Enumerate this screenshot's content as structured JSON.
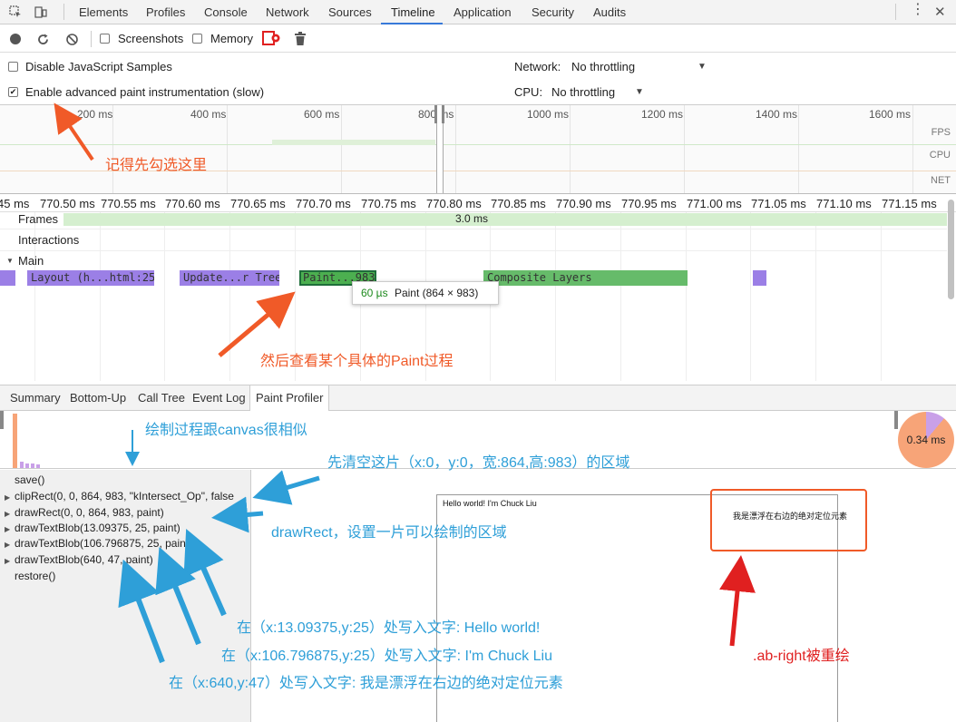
{
  "tabs": [
    "Elements",
    "Profiles",
    "Console",
    "Network",
    "Sources",
    "Timeline",
    "Application",
    "Security",
    "Audits"
  ],
  "active_tab": "Timeline",
  "toolbar": {
    "screenshots_label": "Screenshots",
    "memory_label": "Memory"
  },
  "settings": {
    "disable_js_samples": "Disable JavaScript Samples",
    "enable_paint": "Enable advanced paint instrumentation (slow)",
    "network_label": "Network:",
    "network_value": "No throttling",
    "cpu_label": "CPU:",
    "cpu_value": "No throttling"
  },
  "overview": {
    "ticks": [
      "200 ms",
      "400 ms",
      "600 ms",
      "800 ms",
      "1000 ms",
      "1200 ms",
      "1400 ms",
      "1600 ms"
    ],
    "tracks": [
      "FPS",
      "CPU",
      "NET"
    ]
  },
  "flame": {
    "ticks": [
      "45 ms",
      "770.50 ms",
      "770.55 ms",
      "770.60 ms",
      "770.65 ms",
      "770.70 ms",
      "770.75 ms",
      "770.80 ms",
      "770.85 ms",
      "770.90 ms",
      "770.95 ms",
      "771.00 ms",
      "771.05 ms",
      "771.10 ms",
      "771.15 ms"
    ],
    "rows": {
      "frames": "Frames",
      "frame_duration": "3.0 ms",
      "interactions": "Interactions",
      "main": "Main"
    },
    "events": [
      "Layout (h...html:25)",
      "Update...r Tree",
      "Paint...983)",
      "Composite Layers"
    ],
    "tooltip": {
      "duration": "60 µs",
      "name": "Paint (864 × 983)"
    }
  },
  "bottom_tabs": [
    "Summary",
    "Bottom-Up",
    "Call Tree",
    "Event Log",
    "Paint Profiler"
  ],
  "active_bottom_tab": "Paint Profiler",
  "pie_label": "0.34 ms",
  "commands": [
    {
      "text": "save()",
      "expandable": false
    },
    {
      "text": "clipRect(0, 0, 864, 983, \"kIntersect_Op\", false",
      "expandable": true
    },
    {
      "text": "drawRect(0, 0, 864, 983, paint)",
      "expandable": true
    },
    {
      "text": "drawTextBlob(13.09375, 25, paint)",
      "expandable": true
    },
    {
      "text": "drawTextBlob(106.796875, 25, paint)",
      "expandable": true
    },
    {
      "text": "drawTextBlob(640, 47, paint)",
      "expandable": true
    },
    {
      "text": "restore()",
      "expandable": false
    }
  ],
  "preview": {
    "left_text": "Hello world! I'm Chuck Liu",
    "right_text": "我是漂浮在右边的绝对定位元素"
  },
  "annotations": {
    "check_first": "记得先勾选这里",
    "view_paint": "然后查看某个具体的Paint过程",
    "canvas_similar": "绘制过程跟canvas很相似",
    "clear_area": "先清空这片（x:0，y:0，宽:864,高:983）的区域",
    "draw_rect": "drawRect，设置一片可以绘制的区域",
    "text1": "在（x:13.09375,y:25）处写入文字: Hello world!",
    "text2": "在（x:106.796875,y:25）处写入文字: I'm Chuck Liu",
    "text3": "在（x:640,y:47）处写入文字: 我是漂浮在右边的绝对定位元素",
    "repaint": ".ab-right被重绘"
  },
  "colors": {
    "accent": "#3879d9",
    "annotation_orange": "#f05a28",
    "annotation_blue": "#2e9fd8",
    "annotation_red": "#e02020",
    "layout": "#9b7fe6",
    "paint": "#4caf50",
    "composite": "#66bb6a"
  }
}
